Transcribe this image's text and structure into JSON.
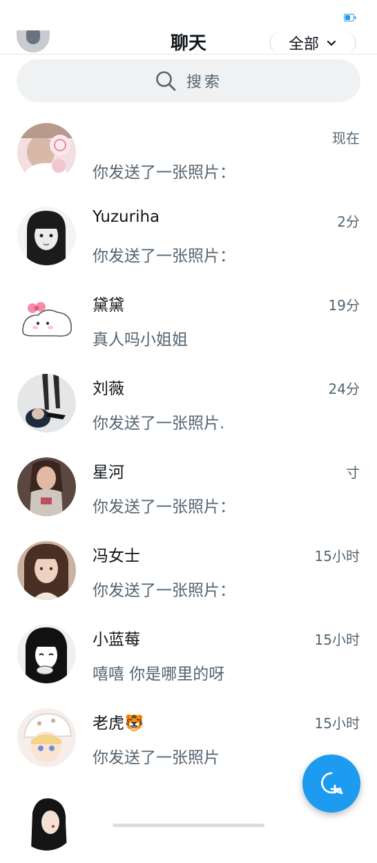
{
  "header": {
    "title": "聊天",
    "filter_label": "全部"
  },
  "search": {
    "placeholder": "搜索"
  },
  "chats": [
    {
      "name": "",
      "time": "现在",
      "preview": "你发送了一张照片："
    },
    {
      "name": "Yuzuriha",
      "time": "2分",
      "preview": "你发送了一张照片："
    },
    {
      "name": "黛黛",
      "time": "19分",
      "preview": "真人吗小姐姐"
    },
    {
      "name": "刘薇",
      "time": "24分",
      "preview": "你发送了一张照片."
    },
    {
      "name": "星河",
      "time": "寸",
      "preview": "你发送了一张照片："
    },
    {
      "name": "冯女士",
      "time": "15小时",
      "preview": "你发送了一张照片："
    },
    {
      "name": "小蓝莓",
      "time": "15小时",
      "preview": "嘻嘻 你是哪里的呀"
    },
    {
      "name": "老虎🐯",
      "time": "15小时",
      "preview": "你发送了一张照片"
    },
    {
      "name": "",
      "time": "",
      "preview": ""
    }
  ],
  "icons": {
    "search": "search-icon",
    "filter": "chevron-down-icon",
    "compose": "compose-message-icon",
    "battery": "battery-icon"
  },
  "colors": {
    "accent": "#1d9bf0",
    "text_primary": "#0f1419",
    "text_secondary": "#536471",
    "search_bg": "#eff1f3"
  }
}
